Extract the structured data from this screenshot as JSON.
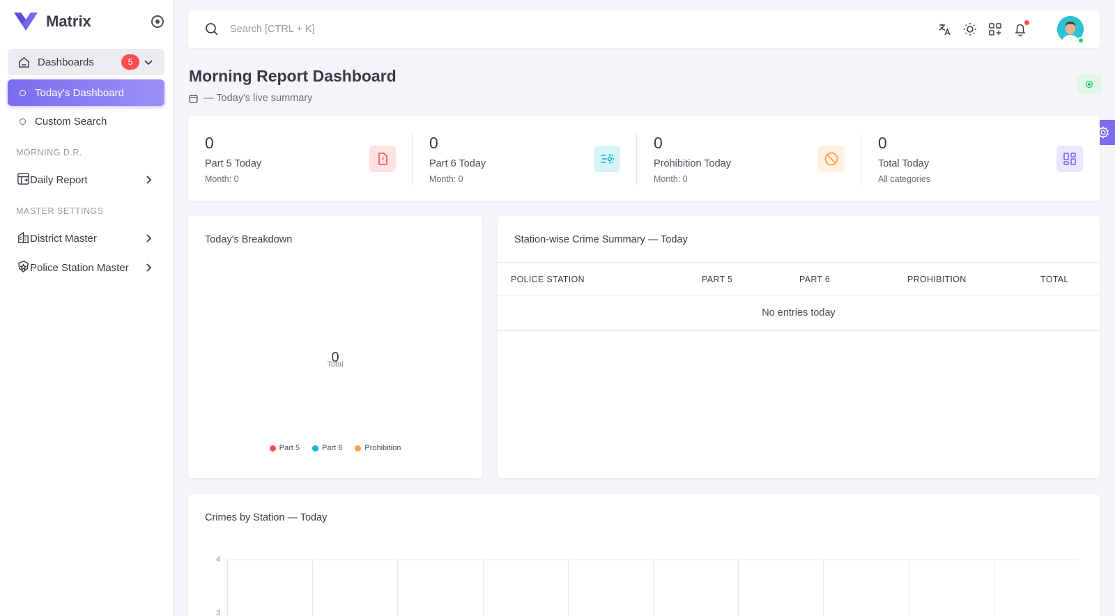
{
  "sidebar": {
    "brand": "Matrix",
    "dashboards_label": "Dashboards",
    "dashboards_badge": "5",
    "today_dashboard": "Today's Dashboard",
    "custom_search": "Custom Search",
    "section_morning": "MORNING D.R.",
    "daily_report": "Daily Report",
    "section_master": "MASTER SETTINGS",
    "district_master": "District Master",
    "police_station_master": "Police Station Master"
  },
  "topbar": {
    "search_placeholder": "Search [CTRL + K]",
    "icons": [
      "translate-icon",
      "sun-icon",
      "shortcuts-icon",
      "bell-icon"
    ]
  },
  "header": {
    "title": "Morning Report Dashboard",
    "subtitle": "— Today's live summary"
  },
  "stats": [
    {
      "value": "0",
      "label": "Part 5 Today",
      "sub": "Month: 0",
      "color": "#ff4c51",
      "bg": "#ffe2e3"
    },
    {
      "value": "0",
      "label": "Part 6 Today",
      "sub": "Month: 0",
      "color": "#00bad1",
      "bg": "#d6f4f8"
    },
    {
      "value": "0",
      "label": "Prohibition Today",
      "sub": "Month: 0",
      "color": "#ff9f43",
      "bg": "#fff0e1"
    },
    {
      "value": "0",
      "label": "Total Today",
      "sub": "All categories",
      "color": "#7367f0",
      "bg": "#e9e7fd"
    }
  ],
  "breakdown": {
    "title": "Today's Breakdown",
    "total_value": "0",
    "total_label": "Total",
    "legend": [
      {
        "name": "Part 5",
        "color": "#ff4c51"
      },
      {
        "name": "Part 6",
        "color": "#00bad1"
      },
      {
        "name": "Prohibition",
        "color": "#ff9f43"
      }
    ]
  },
  "station_table": {
    "title": "Station-wise Crime Summary — Today",
    "columns": [
      "POLICE STATION",
      "PART 5",
      "PART 6",
      "PROHIBITION",
      "TOTAL"
    ],
    "empty_text": "No entries today"
  },
  "crimes_chart": {
    "title": "Crimes by Station — Today"
  },
  "chart_data": {
    "type": "bar",
    "categories": [],
    "series": [],
    "ylim": [
      0,
      4
    ],
    "yticks_visible": [
      "4",
      "3"
    ],
    "grid": true
  }
}
